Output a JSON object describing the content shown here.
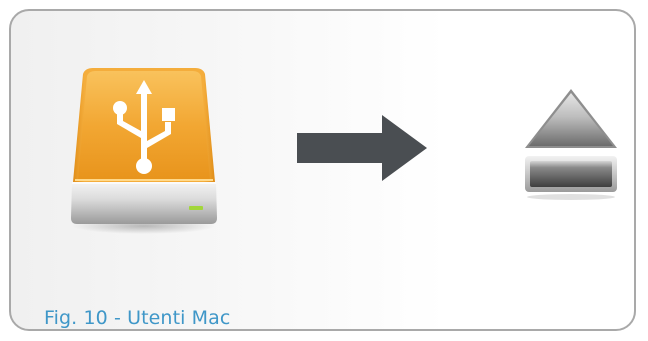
{
  "figure": {
    "caption": "Fig. 10 - Utenti Mac"
  },
  "icons": {
    "drive": "usb-external-drive-icon",
    "arrow": "right-arrow-icon",
    "eject": "eject-icon"
  },
  "colors": {
    "caption": "#3f97c8",
    "frame_border": "#a9a9a9",
    "drive_orange": "#f2a733",
    "arrow": "#4a4e52",
    "led": "#a2d63a"
  }
}
